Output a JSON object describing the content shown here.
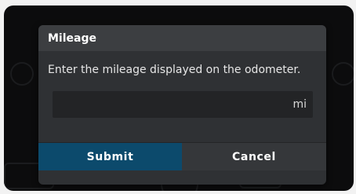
{
  "dialog": {
    "title": "Mileage",
    "message": "Enter the mileage displayed on the odometer.",
    "input": {
      "value": "",
      "unit": "mi"
    },
    "buttons": {
      "submit": "Submit",
      "cancel": "Cancel"
    }
  },
  "colors": {
    "primary_button": "#0c4a6c",
    "dialog_background": "#2f3134",
    "header_background": "#3c3e41",
    "input_background": "#232426"
  }
}
